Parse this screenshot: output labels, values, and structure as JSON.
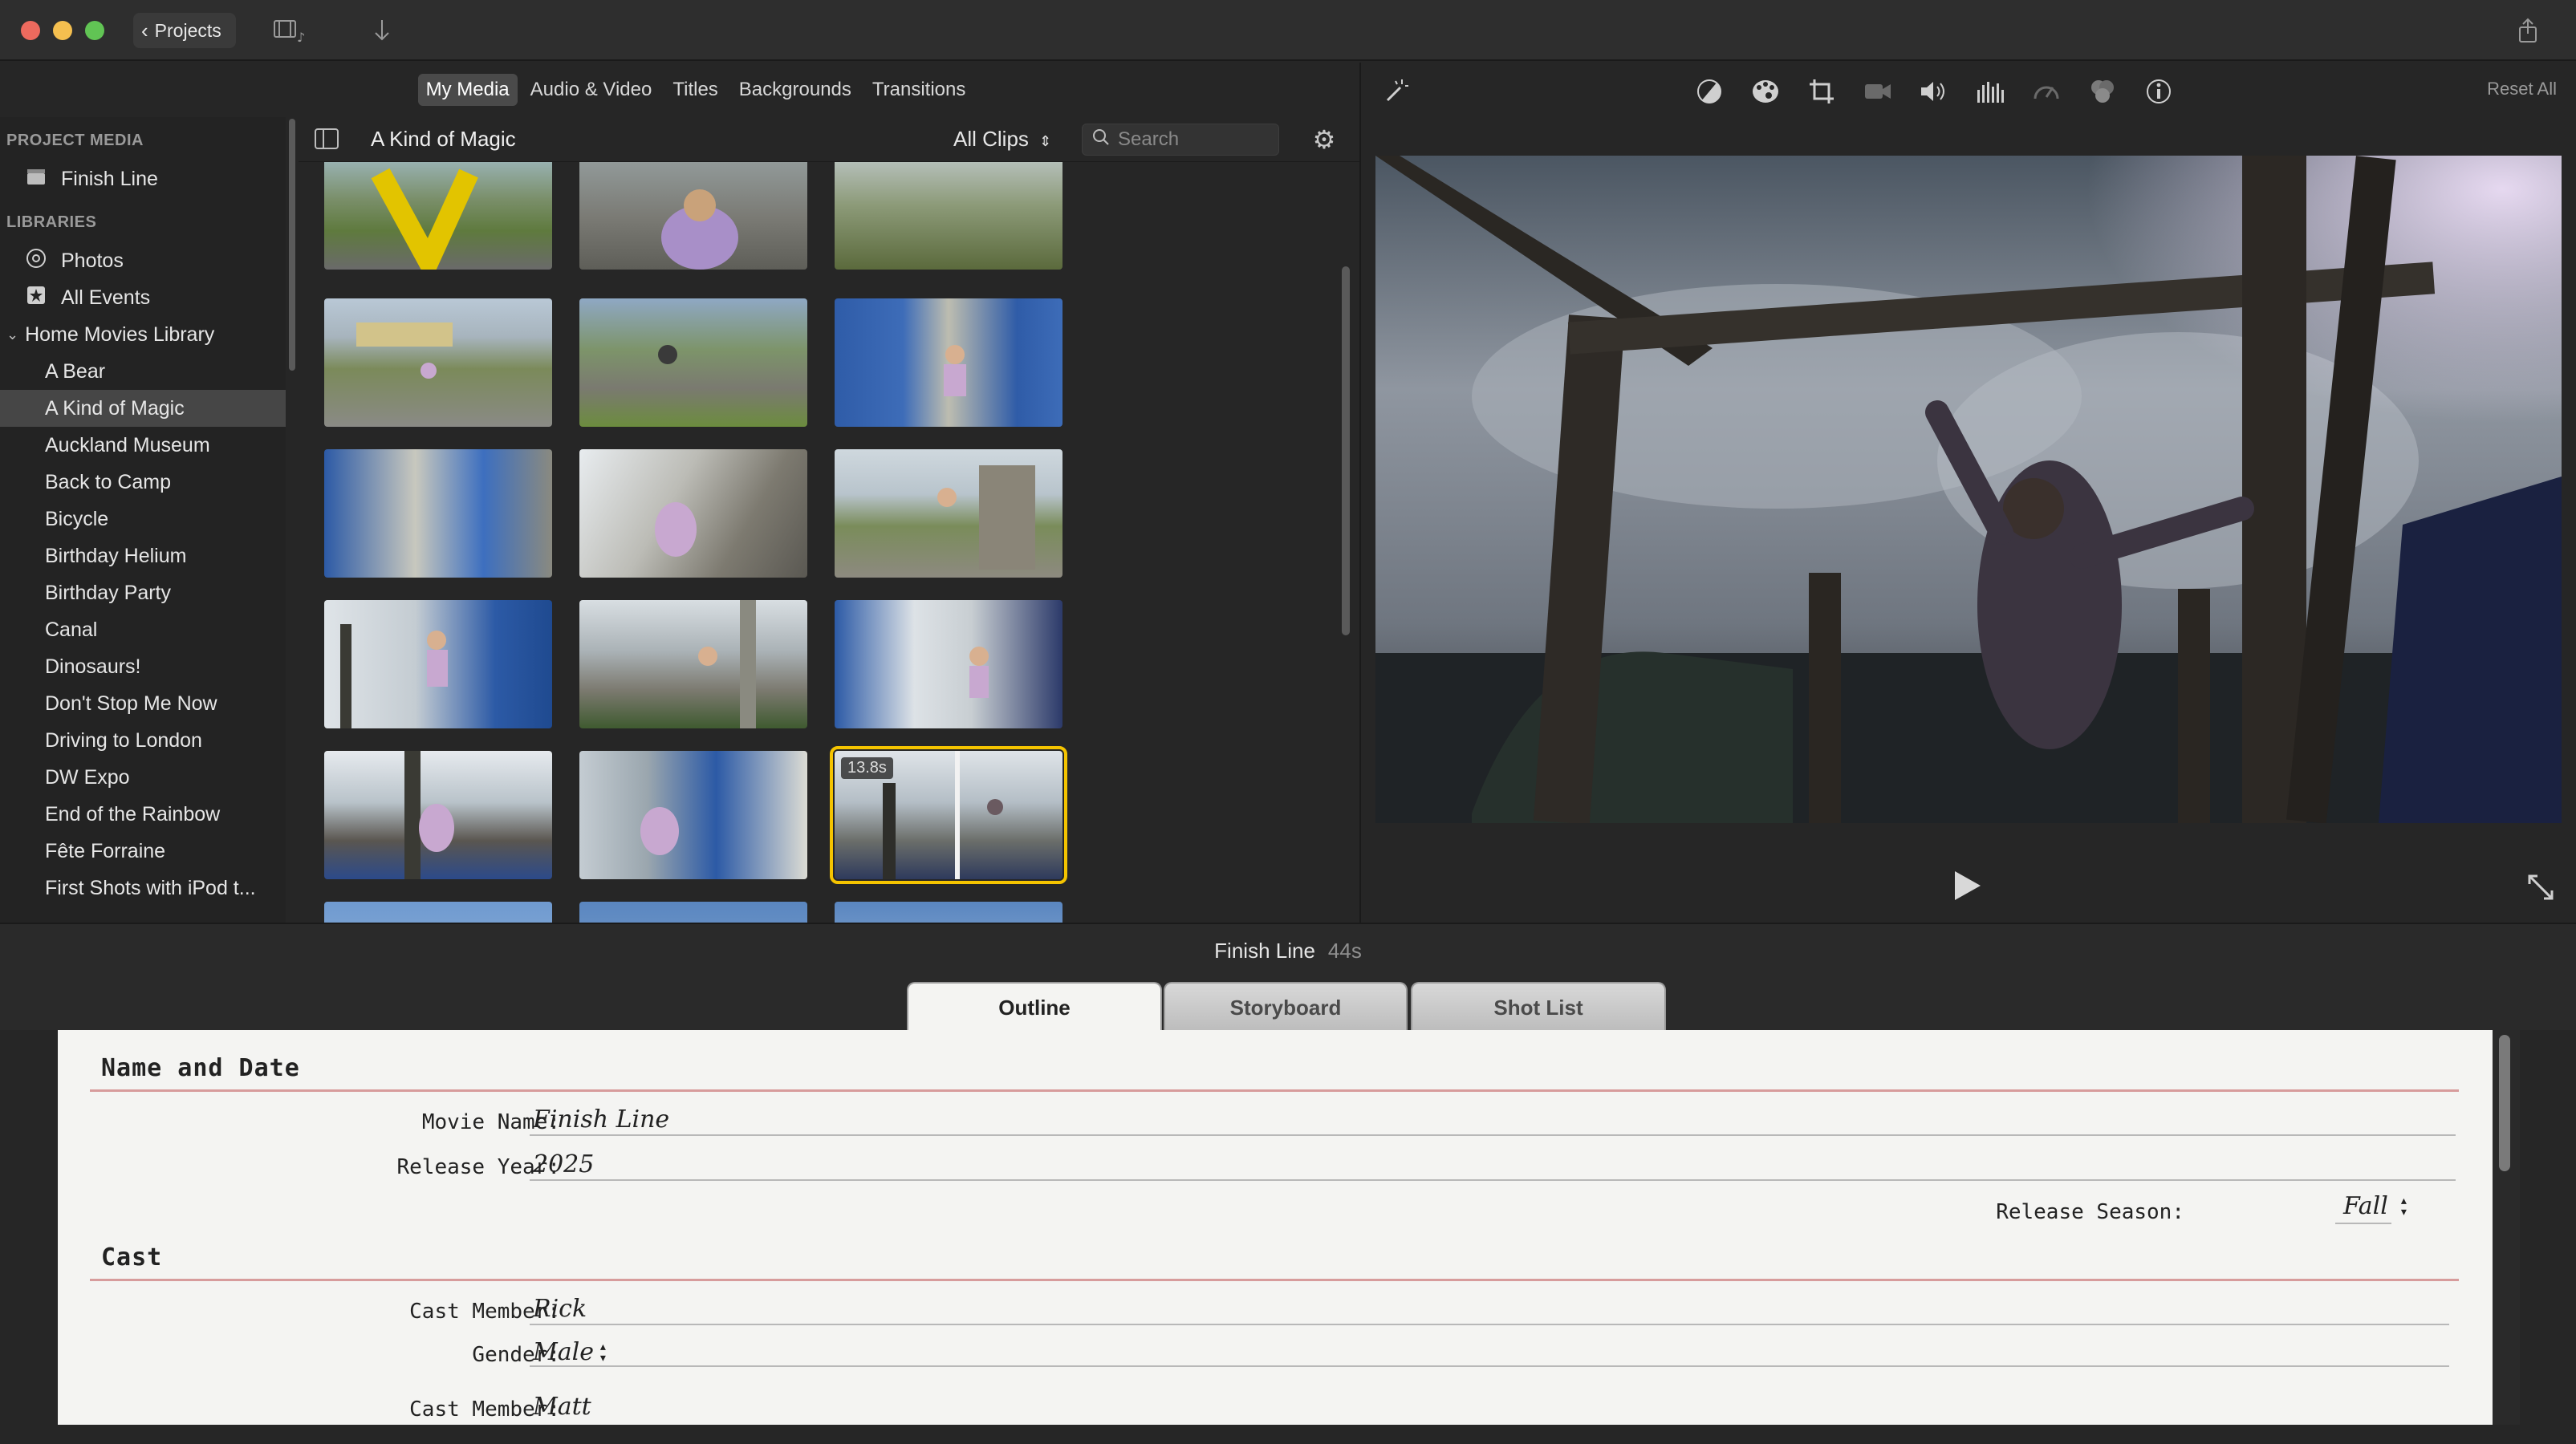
{
  "titlebar": {
    "projects_label": "Projects"
  },
  "browser_tabs": [
    "My Media",
    "Audio & Video",
    "Titles",
    "Backgrounds",
    "Transitions"
  ],
  "sidebar": {
    "project_media_heading": "PROJECT MEDIA",
    "project_item": "Finish Line",
    "libraries_heading": "LIBRARIES",
    "photos": "Photos",
    "all_events": "All Events",
    "library_name": "Home Movies Library",
    "events": [
      "A Bear",
      "A Kind of Magic",
      "Auckland Museum",
      "Back to Camp",
      "Bicycle",
      "Birthday Helium",
      "Birthday Party",
      "Canal",
      "Dinosaurs!",
      "Don't Stop Me Now",
      "Driving to London",
      "DW Expo",
      "End of the Rainbow",
      "Fête Forraine",
      "First Shots with iPod t..."
    ],
    "selected_event": "A Kind of Magic"
  },
  "browser": {
    "event_title": "A Kind of Magic",
    "filter": "All Clips",
    "search_placeholder": "Search",
    "selected_clip_duration": "13.8s"
  },
  "viewer": {
    "reset_all": "Reset All"
  },
  "project": {
    "name": "Finish Line",
    "duration": "44s"
  },
  "outline_tabs": [
    "Outline",
    "Storyboard",
    "Shot List"
  ],
  "outline": {
    "section_name_date": "Name and Date",
    "movie_name_label": "Movie Name:",
    "movie_name": "Finish Line",
    "release_year_label": "Release Year:",
    "release_year": "2025",
    "release_season_label": "Release Season:",
    "release_season": "Fall",
    "section_cast": "Cast",
    "cast_member_label": "Cast Member:",
    "cast_member_1": "Rick",
    "gender_label": "Gender:",
    "gender_1": "Male",
    "cast_member_2": "Matt"
  },
  "colors": {
    "selection_yellow": "#f5c400",
    "rule_red": "#d79c9c",
    "sheet_paper": "#f4f4f2"
  }
}
